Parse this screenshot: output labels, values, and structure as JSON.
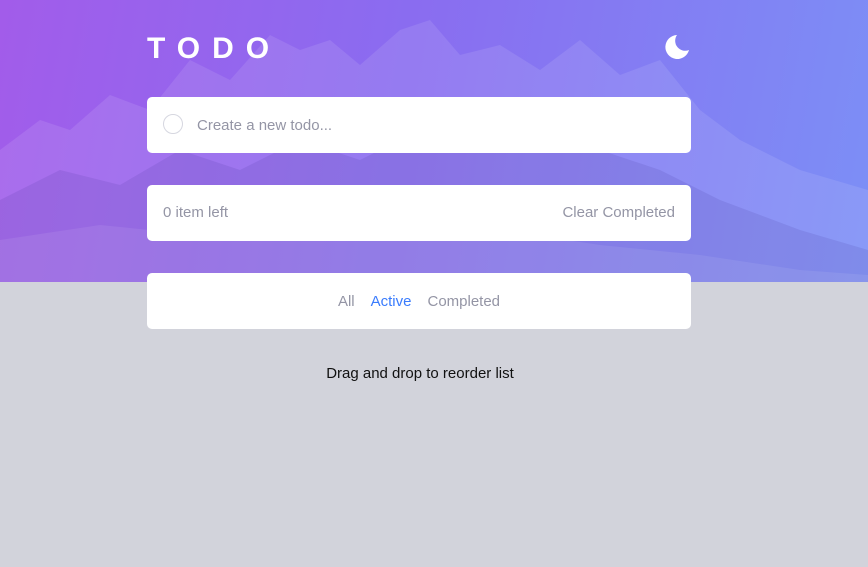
{
  "app": {
    "title": "TODO"
  },
  "header": {
    "theme_toggle_icon": "moon-icon"
  },
  "new_todo": {
    "placeholder": "Create a new todo...",
    "value": ""
  },
  "status": {
    "items_left": "0 item left",
    "clear_label": "Clear Completed"
  },
  "filters": {
    "all": "All",
    "active": "Active",
    "completed": "Completed",
    "selected": "Active"
  },
  "hint": "Drag and drop to reorder list",
  "colors": {
    "accent": "#3a7cfd",
    "background": "#d2d3db",
    "muted_text": "#9495a5",
    "gradient_start": "#a25cea",
    "gradient_end": "#7c8ff6"
  }
}
